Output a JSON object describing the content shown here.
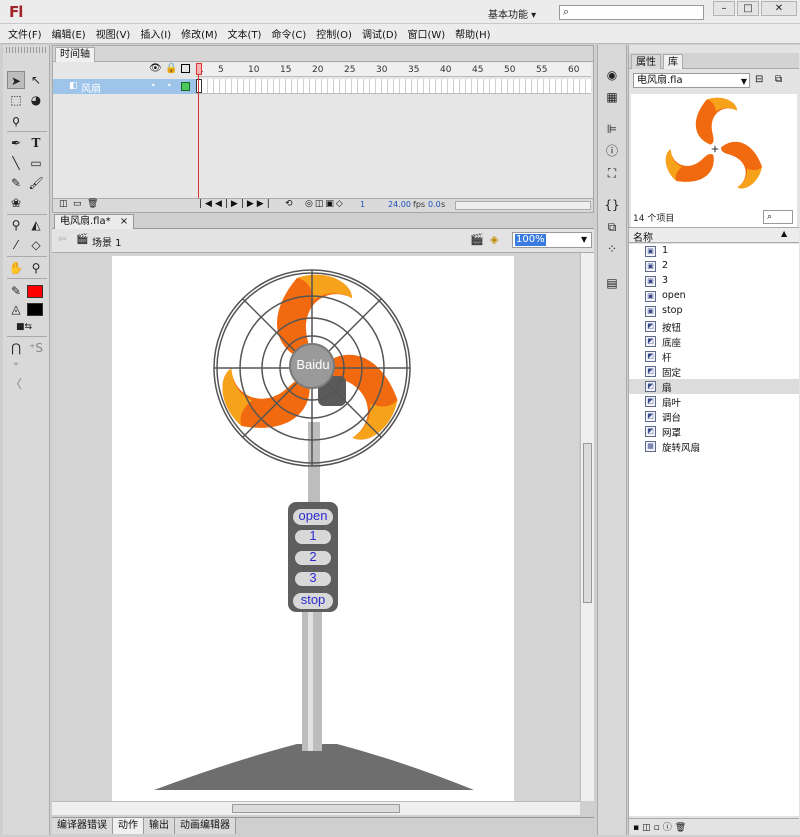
{
  "app": {
    "logo": "Fl",
    "workspace": "基本功能 ▾",
    "search_icon": "search-icon"
  },
  "window_controls": {
    "minimize": "–",
    "maximize": "□",
    "close": "✕"
  },
  "menu": [
    "文件(F)",
    "编辑(E)",
    "视图(V)",
    "插入(I)",
    "修改(M)",
    "文本(T)",
    "命令(C)",
    "控制(O)",
    "调试(D)",
    "窗口(W)",
    "帮助(H)"
  ],
  "timeline": {
    "tab": "时间轴",
    "layer_name": "风扇",
    "ruler": [
      "1",
      "5",
      "10",
      "15",
      "20",
      "25",
      "30",
      "35",
      "40",
      "45",
      "50",
      "55",
      "60"
    ],
    "fps": "24.00",
    "fps_unit": "fps",
    "time": "0.0",
    "time_unit": "s",
    "current_frame": "1"
  },
  "document": {
    "tab": "电风扇.fla*",
    "close": "×",
    "scene": "场景 1",
    "zoom": "100%"
  },
  "stage": {
    "hub_label": "Baidu",
    "buttons": [
      "open",
      "1",
      "2",
      "3",
      "stop"
    ],
    "colors": {
      "blade_dark": "#f26a0f",
      "blade_light": "#f7a21b",
      "hub": "#9a9a9a",
      "panel": "#5e5e5e",
      "base": "#6e6e6e"
    }
  },
  "bottom_tabs": [
    "编译器错误",
    "动作",
    "输出",
    "动画编辑器"
  ],
  "library": {
    "tabs": [
      "属性",
      "库"
    ],
    "file": "电风扇.fla",
    "item_count": "14 个项目",
    "column": "名称",
    "items": [
      "1",
      "2",
      "3",
      "open",
      "stop",
      "按钮",
      "底座",
      "杆",
      "固定",
      "扇",
      "扇叶",
      "调台",
      "网罩",
      "旋转风扇"
    ],
    "selected": "扇"
  }
}
